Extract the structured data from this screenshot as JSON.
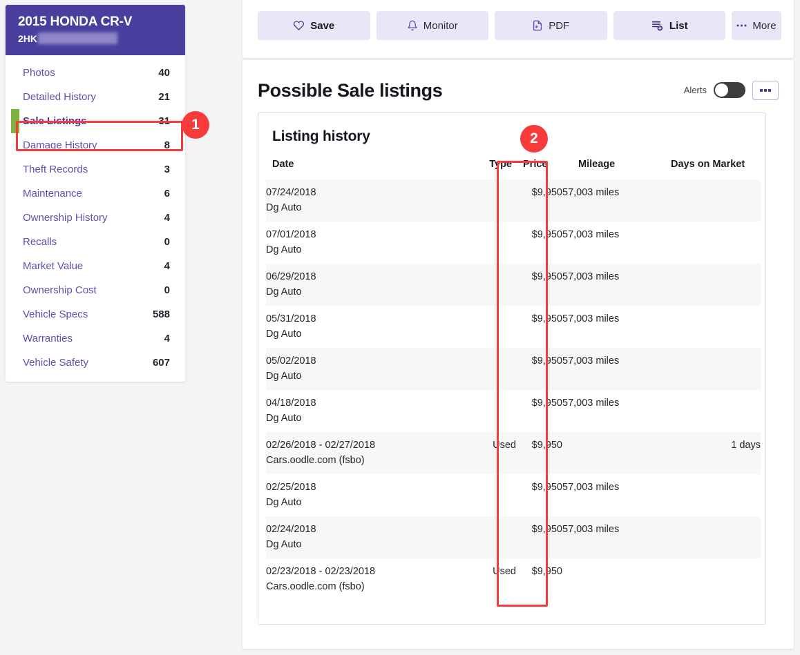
{
  "sidebar": {
    "vehicle_title": "2015 HONDA CR-V",
    "vin_prefix": "2HK",
    "items": [
      {
        "label": "Photos",
        "count": "40",
        "active": false
      },
      {
        "label": "Detailed History",
        "count": "21",
        "active": false
      },
      {
        "label": "Sale Listings",
        "count": "31",
        "active": true
      },
      {
        "label": "Damage History",
        "count": "8",
        "active": false
      },
      {
        "label": "Theft Records",
        "count": "3",
        "active": false
      },
      {
        "label": "Maintenance",
        "count": "6",
        "active": false
      },
      {
        "label": "Ownership History",
        "count": "4",
        "active": false
      },
      {
        "label": "Recalls",
        "count": "0",
        "active": false
      },
      {
        "label": "Market Value",
        "count": "4",
        "active": false
      },
      {
        "label": "Ownership Cost",
        "count": "0",
        "active": false
      },
      {
        "label": "Vehicle Specs",
        "count": "588",
        "active": false
      },
      {
        "label": "Warranties",
        "count": "4",
        "active": false
      },
      {
        "label": "Vehicle Safety",
        "count": "607",
        "active": false
      }
    ]
  },
  "toolbar": {
    "save_label": "Save",
    "monitor_label": "Monitor",
    "pdf_label": "PDF",
    "list_label": "List",
    "more_label": "More"
  },
  "panel": {
    "title": "Possible Sale listings",
    "alerts_label": "Alerts",
    "alerts_on": false,
    "listing_title": "Listing history"
  },
  "table": {
    "columns": [
      "Date",
      "Type",
      "Price",
      "Mileage",
      "Days on Market"
    ],
    "rows": [
      {
        "date": "07/24/2018",
        "source": "Dg Auto",
        "type": "",
        "price": "$9,950",
        "mileage": "57,003 miles",
        "days": ""
      },
      {
        "date": "07/01/2018",
        "source": "Dg Auto",
        "type": "",
        "price": "$9,950",
        "mileage": "57,003 miles",
        "days": ""
      },
      {
        "date": "06/29/2018",
        "source": "Dg Auto",
        "type": "",
        "price": "$9,950",
        "mileage": "57,003 miles",
        "days": ""
      },
      {
        "date": "05/31/2018",
        "source": "Dg Auto",
        "type": "",
        "price": "$9,950",
        "mileage": "57,003 miles",
        "days": ""
      },
      {
        "date": "05/02/2018",
        "source": "Dg Auto",
        "type": "",
        "price": "$9,950",
        "mileage": "57,003 miles",
        "days": ""
      },
      {
        "date": "04/18/2018",
        "source": "Dg Auto",
        "type": "",
        "price": "$9,950",
        "mileage": "57,003 miles",
        "days": ""
      },
      {
        "date": "02/26/2018 - 02/27/2018",
        "source": "Cars.oodle.com (fsbo)",
        "type": "Used",
        "price": "$9,950",
        "mileage": "",
        "days": "1 days"
      },
      {
        "date": "02/25/2018",
        "source": "Dg Auto",
        "type": "",
        "price": "$9,950",
        "mileage": "57,003 miles",
        "days": ""
      },
      {
        "date": "02/24/2018",
        "source": "Dg Auto",
        "type": "",
        "price": "$9,950",
        "mileage": "57,003 miles",
        "days": ""
      },
      {
        "date": "02/23/2018 - 02/23/2018",
        "source": "Cars.oodle.com (fsbo)",
        "type": "Used",
        "price": "$9,950",
        "mileage": "",
        "days": ""
      }
    ]
  },
  "annotations": [
    {
      "number": "1",
      "target": "sale-listings-nav-item"
    },
    {
      "number": "2",
      "target": "price-column"
    }
  ],
  "colors": {
    "brand_purple": "#4a3f9f",
    "accent_green": "#7cb342",
    "annotation_red": "#f73b3b",
    "button_bg": "#e8e6f7"
  }
}
